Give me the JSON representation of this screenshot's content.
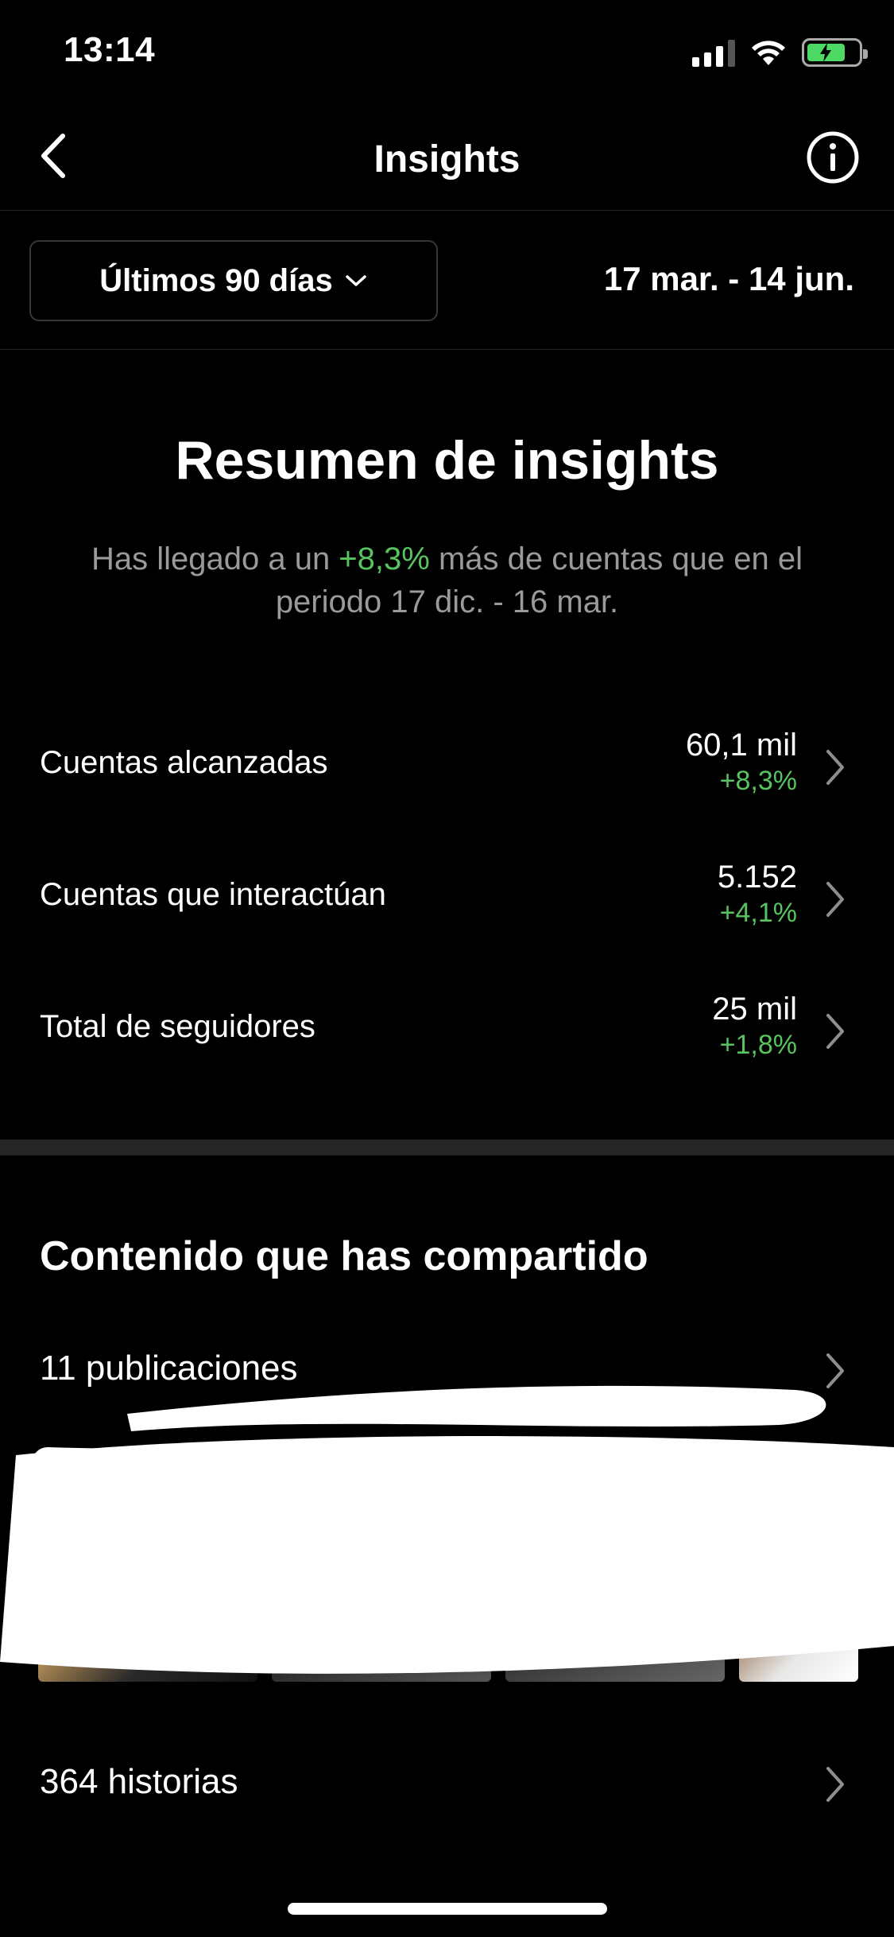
{
  "status_bar": {
    "time": "13:14"
  },
  "header": {
    "title": "Insights"
  },
  "filter": {
    "range_label": "Últimos 90 días",
    "date_range": "17 mar. - 14 jun."
  },
  "summary": {
    "title": "Resumen de insights",
    "text_before": "Has llegado a un ",
    "highlight": "+8,3%",
    "text_after": " más de cuentas que en el periodo 17 dic. - 16 mar."
  },
  "metrics": [
    {
      "label": "Cuentas alcanzadas",
      "value": "60,1 mil",
      "delta": "+8,3%"
    },
    {
      "label": "Cuentas que interactúan",
      "value": "5.152",
      "delta": "+4,1%"
    },
    {
      "label": "Total de seguidores",
      "value": "25 mil",
      "delta": "+1,8%"
    }
  ],
  "content": {
    "title": "Contenido que has compartido",
    "posts_label": "11 publicaciones",
    "stories_label": "364 historias"
  },
  "colors": {
    "positive": "#58c45f",
    "background": "#000000",
    "divider": "#262626"
  }
}
